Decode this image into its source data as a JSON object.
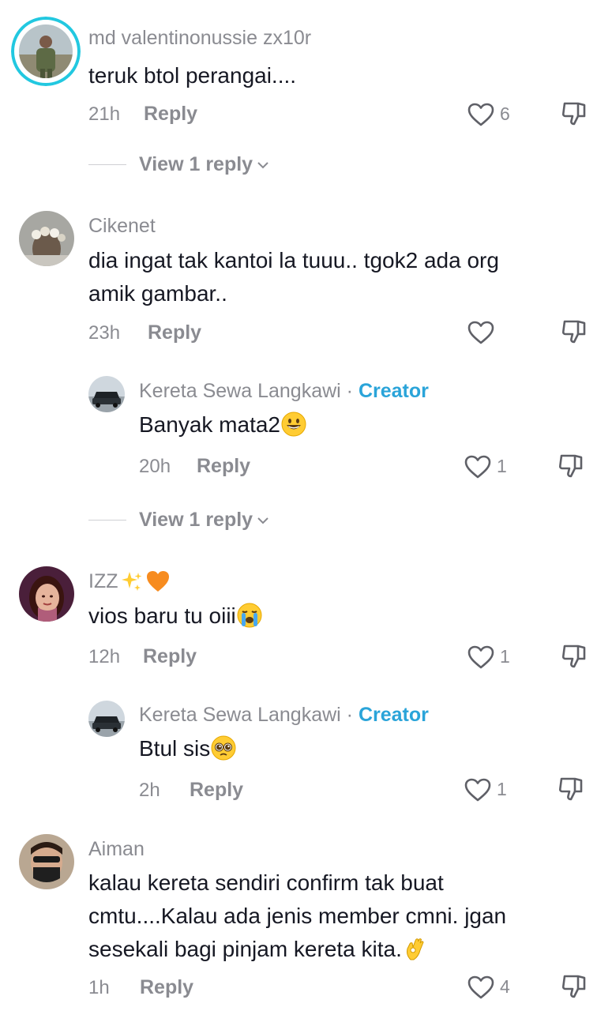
{
  "comments": [
    {
      "username": "md valentinonussie zx10r",
      "text": "teruk btol perangai....",
      "time": "21h",
      "reply_label": "Reply",
      "likes": "6",
      "view_replies": "View 1 reply"
    },
    {
      "username": "Cikenet",
      "text_lines": [
        "dia ingat tak kantoi la tuuu.. tgok2 ada org",
        "amik gambar.."
      ],
      "time": "23h",
      "reply_label": "Reply",
      "likes": "",
      "reply": {
        "username": "Kereta Sewa Langkawi",
        "separator": "·",
        "badge": "Creator",
        "text": "Banyak mata2",
        "emoji": "grinning-face-emoji",
        "time": "20h",
        "reply_label": "Reply",
        "likes": "1"
      },
      "view_replies": "View 1 reply"
    },
    {
      "username": "IZZ",
      "username_emojis": [
        "sparkles-emoji",
        "orange-heart-emoji"
      ],
      "text": "vios baru tu oiii",
      "emoji": "loudly-crying-face-emoji",
      "time": "12h",
      "reply_label": "Reply",
      "likes": "1",
      "reply": {
        "username": "Kereta Sewa Langkawi",
        "separator": "·",
        "badge": "Creator",
        "text": "Btul sis",
        "emoji": "pleading-face-emoji",
        "time": "2h",
        "reply_label": "Reply",
        "likes": "1"
      }
    },
    {
      "username": "Aiman",
      "text_lines": [
        "kalau kereta sendiri confirm tak buat",
        "cmtu....Kalau ada jenis member cmni. jgan",
        "sesekali bagi pinjam kereta kita."
      ],
      "emoji": "ok-hand-emoji",
      "time": "1h",
      "reply_label": "Reply",
      "likes": "4"
    }
  ],
  "colors": {
    "text": "#161823",
    "muted": "#8a8b91",
    "creator": "#2aa4d9",
    "story_ring": "#22c8e0"
  },
  "icons": {
    "like": "heart-outline-icon",
    "dislike": "thumbs-down-outline-icon",
    "expand": "chevron-down-icon"
  }
}
